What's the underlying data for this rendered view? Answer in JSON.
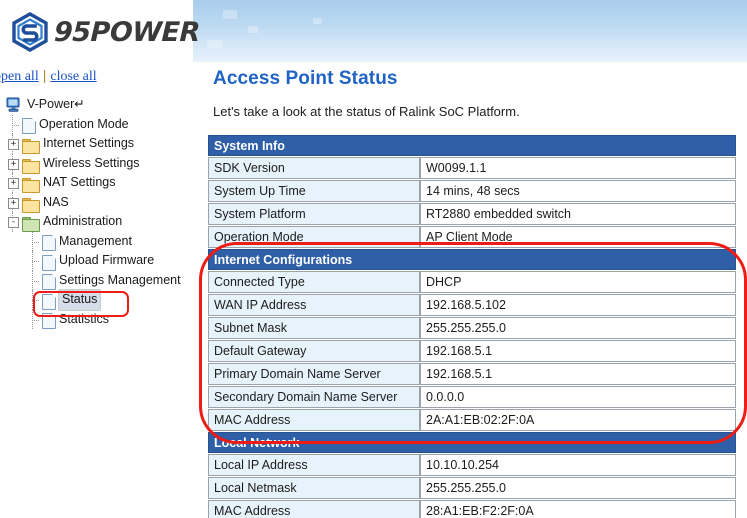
{
  "brand": {
    "name": "95POWER",
    "logo_icon": "hexagon-s-logo"
  },
  "sidebar": {
    "open_all": "open all",
    "close_all": "close all",
    "separator": "|",
    "root": {
      "label": "V-Power↵",
      "icon": "computer-icon"
    },
    "items": [
      {
        "label": "Operation Mode",
        "icon": "page-icon",
        "type": "leaf",
        "depth": 1,
        "toggle": ""
      },
      {
        "label": "Internet Settings",
        "icon": "folder-icon",
        "type": "folder",
        "depth": 1,
        "toggle": "+"
      },
      {
        "label": "Wireless Settings",
        "icon": "folder-icon",
        "type": "folder",
        "depth": 1,
        "toggle": "+"
      },
      {
        "label": "NAT Settings",
        "icon": "folder-icon",
        "type": "folder",
        "depth": 1,
        "toggle": "+"
      },
      {
        "label": "NAS",
        "icon": "folder-icon",
        "type": "folder",
        "depth": 1,
        "toggle": "+"
      },
      {
        "label": "Administration",
        "icon": "folder-open-icon",
        "type": "folder",
        "depth": 1,
        "toggle": "-"
      },
      {
        "label": "Management",
        "icon": "page-icon",
        "type": "leaf",
        "depth": 2,
        "toggle": ""
      },
      {
        "label": "Upload Firmware",
        "icon": "page-icon",
        "type": "leaf",
        "depth": 2,
        "toggle": ""
      },
      {
        "label": "Settings Management",
        "icon": "page-icon",
        "type": "leaf",
        "depth": 2,
        "toggle": ""
      },
      {
        "label": "Status",
        "icon": "page-icon",
        "type": "leaf",
        "depth": 2,
        "toggle": "",
        "selected": true
      },
      {
        "label": "Statistics",
        "icon": "page-icon",
        "type": "leaf",
        "depth": 2,
        "toggle": ""
      }
    ]
  },
  "main": {
    "title": "Access Point Status",
    "subtitle": "Let's take a look at the status of Ralink SoC Platform.",
    "sections": [
      {
        "header": "System Info",
        "rows": [
          {
            "label": "SDK Version",
            "value": "W0099.1.1"
          },
          {
            "label": "System Up Time",
            "value": "14 mins, 48 secs"
          },
          {
            "label": "System Platform",
            "value": "RT2880 embedded switch"
          },
          {
            "label": "Operation Mode",
            "value": "AP Client Mode"
          }
        ]
      },
      {
        "header": "Internet Configurations",
        "rows": [
          {
            "label": "Connected Type",
            "value": "DHCP"
          },
          {
            "label": "WAN IP Address",
            "value": "192.168.5.102"
          },
          {
            "label": "Subnet Mask",
            "value": "255.255.255.0"
          },
          {
            "label": "Default Gateway",
            "value": "192.168.5.1"
          },
          {
            "label": "Primary Domain Name Server",
            "value": "192.168.5.1"
          },
          {
            "label": "Secondary Domain Name Server",
            "value": "0.0.0.0"
          },
          {
            "label": "MAC Address",
            "value": "2A:A1:EB:02:2F:0A"
          }
        ]
      },
      {
        "header": "Local Network",
        "rows": [
          {
            "label": "Local IP Address",
            "value": "10.10.10.254"
          },
          {
            "label": "Local Netmask",
            "value": "255.255.255.0"
          },
          {
            "label": "MAC Address",
            "value": "28:A1:EB:F2:2F:0A"
          }
        ]
      }
    ]
  },
  "annotations": [
    {
      "name": "highlight-status-menu-item",
      "shape": "rounded-rect"
    },
    {
      "name": "highlight-internet-configurations",
      "shape": "rounded-rect"
    }
  ],
  "colors": {
    "accent_blue": "#1f63c4",
    "section_header": "#2f5fa6",
    "label_cell": "#e6f3fb",
    "annotation_red": "#ee1c16",
    "link_blue": "#1a52c4"
  }
}
